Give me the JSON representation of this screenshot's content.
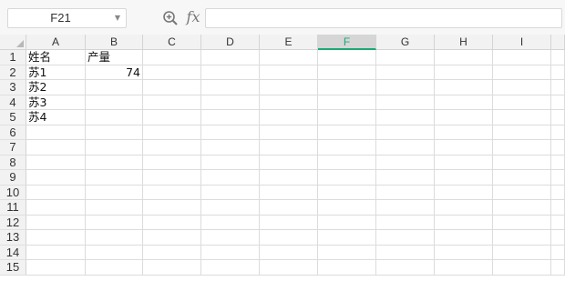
{
  "formula_bar": {
    "name_box": "F21",
    "dropdown_icon": "chevron-down-icon",
    "zoom_icon": "zoom-icon",
    "fx_label": "fx",
    "formula_value": ""
  },
  "columns": [
    "A",
    "B",
    "C",
    "D",
    "E",
    "F",
    "G",
    "H",
    "I"
  ],
  "active_column": "F",
  "rows": [
    "1",
    "2",
    "3",
    "4",
    "5",
    "6",
    "7",
    "8",
    "9",
    "10",
    "11",
    "12",
    "13",
    "14",
    "15"
  ],
  "cells": {
    "A1": "姓名",
    "B1": "产量",
    "A2": "苏1",
    "B2": "74",
    "A3": "苏2",
    "A4": "苏3",
    "A5": "苏4"
  },
  "colors": {
    "active_header": "#1aaa73",
    "gridline": "#dcdcdc",
    "header_bg": "#f2f2f2"
  }
}
